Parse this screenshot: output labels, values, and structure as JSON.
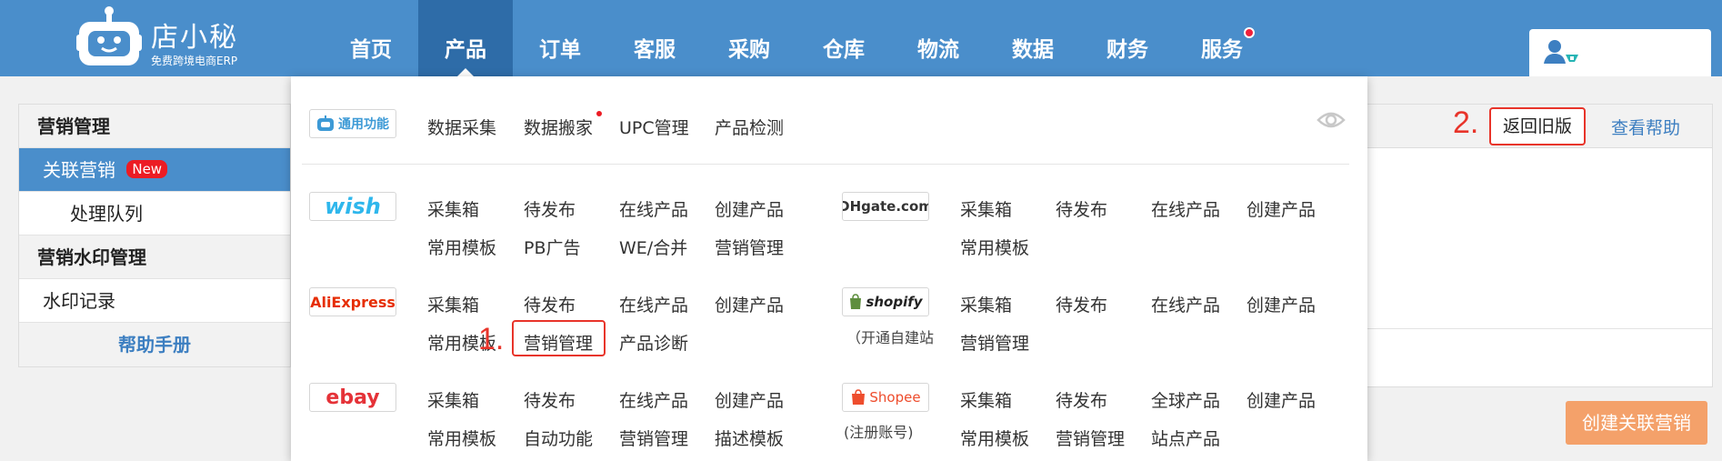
{
  "header": {
    "brand_name": "店小秘",
    "brand_tagline": "免费跨境电商ERP",
    "nav": [
      {
        "label": "首页"
      },
      {
        "label": "产品",
        "active": true
      },
      {
        "label": "订单"
      },
      {
        "label": "客服"
      },
      {
        "label": "采购"
      },
      {
        "label": "仓库"
      },
      {
        "label": "物流"
      },
      {
        "label": "数据"
      },
      {
        "label": "财务"
      },
      {
        "label": "服务",
        "has_dot": true
      }
    ],
    "user_icon": "user-plus-icon",
    "colors": {
      "bar": "#4a8ecb",
      "active_tab": "#2e6ca8",
      "notify_dot": "#f0203a"
    }
  },
  "sidebar": {
    "section1_title": "营销管理",
    "item_related": "关联营销",
    "new_badge": "New",
    "item_queue": "处理队列",
    "section2_title": "营销水印管理",
    "item_watermark": "水印记录",
    "help_manual": "帮助手册"
  },
  "main": {
    "marker_2": "2.",
    "back_old_version": "返回旧版",
    "view_help": "查看帮助",
    "create_button": "创建关联营销"
  },
  "dropdown": {
    "general": {
      "logo_text": "通用功能",
      "links": [
        "数据采集",
        "数据搬家",
        "UPC管理",
        "产品检测"
      ]
    },
    "wish": {
      "logo_text": "wish",
      "row1": [
        "采集箱",
        "待发布",
        "在线产品",
        "创建产品"
      ],
      "row2": [
        "常用模板",
        "PB广告",
        "WE/合并",
        "营销管理"
      ]
    },
    "dhgate": {
      "logo_text": "DHgate.com",
      "row1": [
        "采集箱",
        "待发布",
        "在线产品",
        "创建产品"
      ],
      "row2": [
        "常用模板"
      ]
    },
    "aliexpress": {
      "logo_text": "AliExpress",
      "row1": [
        "采集箱",
        "待发布",
        "在线产品",
        "创建产品"
      ],
      "row2": [
        "常用模板",
        "营销管理",
        "产品诊断"
      ]
    },
    "shopify": {
      "logo_text": "shopify",
      "caption": "（开通自建站",
      "row1": [
        "采集箱",
        "待发布",
        "在线产品",
        "创建产品"
      ],
      "row2": [
        "营销管理"
      ]
    },
    "ebay": {
      "logo_text": "ebay",
      "row1": [
        "采集箱",
        "待发布",
        "在线产品",
        "创建产品"
      ],
      "row2": [
        "常用模板",
        "自动功能",
        "营销管理",
        "描述模板"
      ]
    },
    "shopee": {
      "logo_text": "Shopee",
      "caption": "(注册账号)",
      "row1": [
        "采集箱",
        "待发布",
        "全球产品",
        "创建产品"
      ],
      "row2": [
        "常用模板",
        "营销管理",
        "站点产品"
      ]
    },
    "marker_1": "1.",
    "eye_icon": "eye-icon",
    "colors": {
      "annotation": "#e8342a"
    }
  }
}
